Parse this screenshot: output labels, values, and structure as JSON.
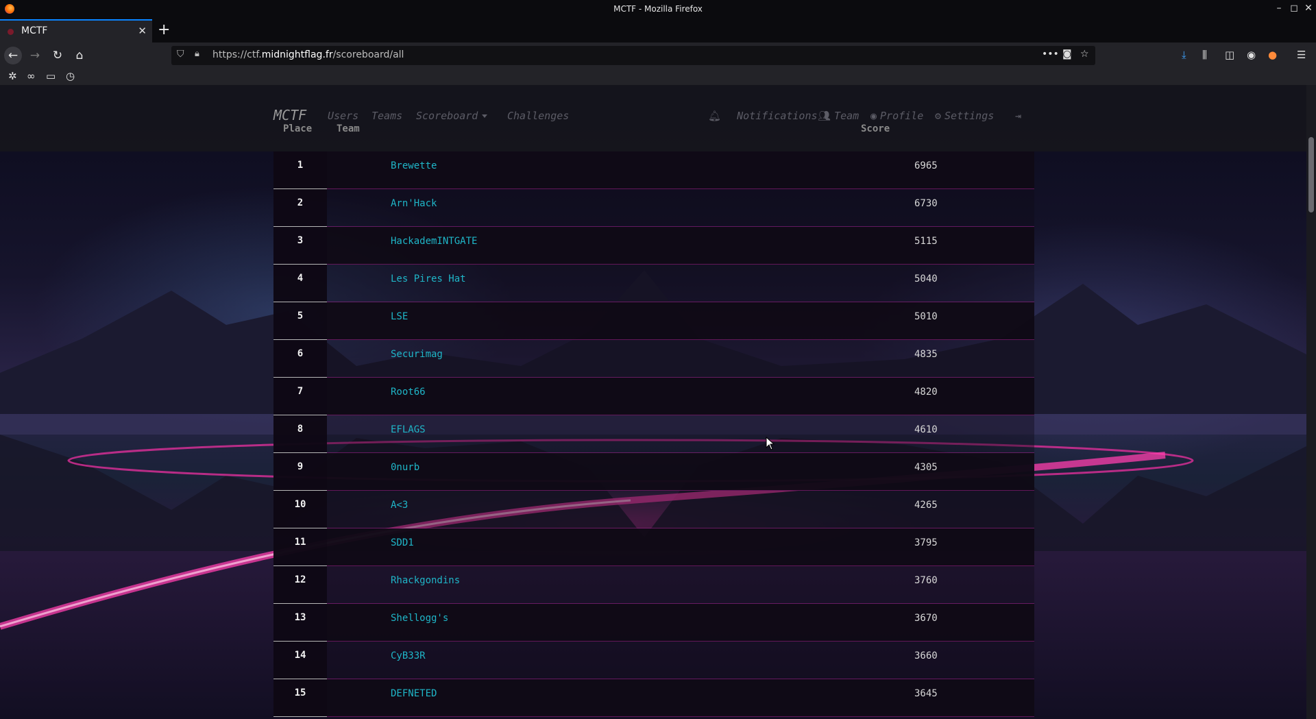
{
  "window": {
    "title": "MCTF - Mozilla Firefox"
  },
  "browser": {
    "tab_title": "MCTF",
    "url_prefix": "https://ctf.",
    "url_domain": "midnightflag.fr",
    "url_path": "/scoreboard/all"
  },
  "nav": {
    "brand": "MCTF",
    "users": "Users",
    "teams": "Teams",
    "scoreboard": "Scoreboard",
    "challenges": "Challenges",
    "notifications": "Notifications",
    "team": "Team",
    "profile": "Profile",
    "settings": "Settings"
  },
  "table": {
    "headers": {
      "place": "Place",
      "team": "Team",
      "score": "Score"
    },
    "rows": [
      {
        "place": "1",
        "team": "Brewette",
        "score": "6965"
      },
      {
        "place": "2",
        "team": "Arn'Hack",
        "score": "6730"
      },
      {
        "place": "3",
        "team": "HackademINTGATE",
        "score": "5115"
      },
      {
        "place": "4",
        "team": "Les Pires Hat",
        "score": "5040"
      },
      {
        "place": "5",
        "team": "LSE",
        "score": "5010"
      },
      {
        "place": "6",
        "team": "Securimag",
        "score": "4835"
      },
      {
        "place": "7",
        "team": "Root66",
        "score": "4820"
      },
      {
        "place": "8",
        "team": "EFLAGS",
        "score": "4610"
      },
      {
        "place": "9",
        "team": "0nurb",
        "score": "4305"
      },
      {
        "place": "10",
        "team": "A<3",
        "score": "4265"
      },
      {
        "place": "11",
        "team": "SDD1",
        "score": "3795"
      },
      {
        "place": "12",
        "team": "Rhackgondins",
        "score": "3760"
      },
      {
        "place": "13",
        "team": "Shellogg's",
        "score": "3670"
      },
      {
        "place": "14",
        "team": "CyB33R",
        "score": "3660"
      },
      {
        "place": "15",
        "team": "DEFNETED",
        "score": "3645"
      }
    ]
  },
  "colors": {
    "link": "#1fb6c8",
    "accent": "#c828aa",
    "nav_bg": "#16161c"
  }
}
